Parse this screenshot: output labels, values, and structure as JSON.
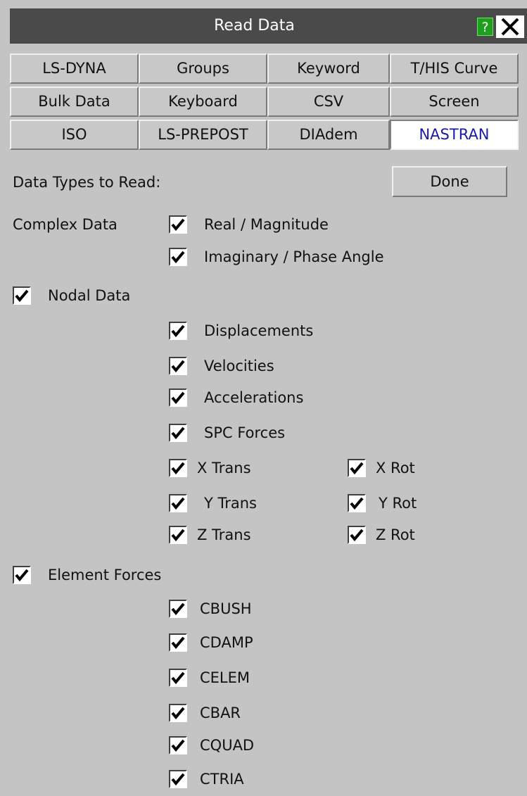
{
  "window": {
    "title": "Read Data",
    "help_label": "?"
  },
  "tabs": [
    {
      "label": "LS-DYNA",
      "active": false
    },
    {
      "label": "Groups",
      "active": false
    },
    {
      "label": "Keyword",
      "active": false
    },
    {
      "label": "T/HIS Curve",
      "active": false
    },
    {
      "label": "Bulk Data",
      "active": false
    },
    {
      "label": "Keyboard",
      "active": false
    },
    {
      "label": "CSV",
      "active": false
    },
    {
      "label": "Screen",
      "active": false
    },
    {
      "label": "ISO",
      "active": false
    },
    {
      "label": "LS-PREPOST",
      "active": false
    },
    {
      "label": "DIAdem",
      "active": false
    },
    {
      "label": "NASTRAN",
      "active": true
    }
  ],
  "data_types_label": "Data Types to Read:",
  "done_label": "Done",
  "complex_data": {
    "label": "Complex Data",
    "options": [
      {
        "label": "Real / Magnitude",
        "checked": true
      },
      {
        "label": "Imaginary / Phase Angle",
        "checked": true
      }
    ]
  },
  "nodal_data": {
    "label": "Nodal Data",
    "checked": true,
    "options": [
      {
        "label": "Displacements",
        "checked": true
      },
      {
        "label": "Velocities",
        "checked": true
      },
      {
        "label": "Accelerations",
        "checked": true
      },
      {
        "label": "SPC Forces",
        "checked": true
      }
    ],
    "trans": [
      {
        "label": "X Trans",
        "checked": true
      },
      {
        "label": "Y Trans",
        "checked": true
      },
      {
        "label": "Z Trans",
        "checked": true
      }
    ],
    "rot": [
      {
        "label": "X Rot",
        "checked": true
      },
      {
        "label": "Y Rot",
        "checked": true
      },
      {
        "label": "Z Rot",
        "checked": true
      }
    ]
  },
  "element_forces": {
    "label": "Element Forces",
    "checked": true,
    "options": [
      {
        "label": "CBUSH",
        "checked": true
      },
      {
        "label": "CDAMP",
        "checked": true
      },
      {
        "label": "CELEM",
        "checked": true
      },
      {
        "label": "CBAR",
        "checked": true
      },
      {
        "label": "CQUAD",
        "checked": true
      },
      {
        "label": "CTRIA",
        "checked": true
      }
    ]
  }
}
